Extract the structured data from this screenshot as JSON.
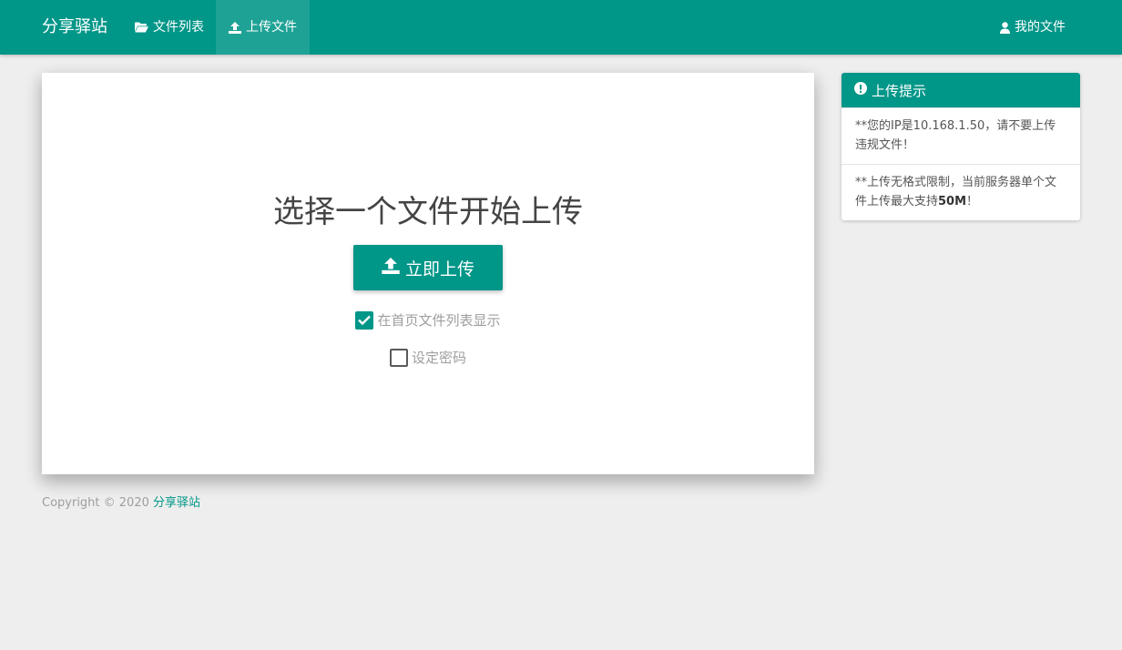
{
  "navbar": {
    "brand": "分享驿站",
    "items": [
      {
        "label": "文件列表",
        "icon": "folder-open-icon"
      },
      {
        "label": "上传文件",
        "icon": "upload-icon",
        "active": true
      }
    ],
    "right_item": {
      "label": "我的文件",
      "icon": "user-icon"
    }
  },
  "upload": {
    "title": "选择一个文件开始上传",
    "button_label": "立即上传",
    "options": [
      {
        "label": "在首页文件列表显示",
        "checked": true
      },
      {
        "label": "设定密码",
        "checked": false
      }
    ]
  },
  "footer": {
    "copyright": "Copyright © 2020 ",
    "site_name": "分享驿站"
  },
  "tips": {
    "title": "上传提示",
    "items": [
      {
        "text": "**您的IP是10.168.1.50，请不要上传违规文件！"
      },
      {
        "text_before": "**上传无格式限制，当前服务器单个文件上传最大支持",
        "highlight": "50M",
        "text_after": "！"
      }
    ]
  },
  "colors": {
    "primary": "#009688",
    "background": "#eeeeee"
  }
}
